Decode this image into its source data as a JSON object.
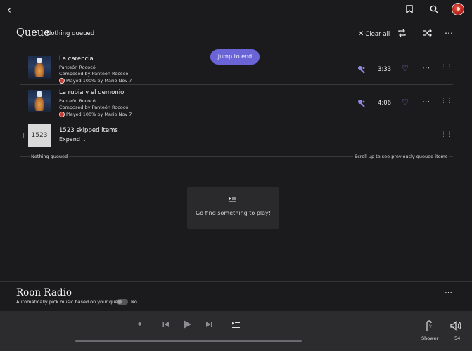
{
  "topbar": {
    "back_icon": "chevron-left-icon",
    "bookmark_icon": "bookmark-icon",
    "search_icon": "search-icon"
  },
  "queue": {
    "title": "Queue",
    "subtitle": "Nothing queued",
    "clear_all": "Clear all",
    "jump_to_end": "Jump to end"
  },
  "tracks": [
    {
      "title": "La carencia",
      "artist": "Panteón Rococó",
      "composer": "Composed by Panteón Rococó",
      "played": "Played 100% by Mario Nov 7",
      "duration": "3:33"
    },
    {
      "title": "La rubia y el demonio",
      "artist": "Panteón Rococó",
      "composer": "Composed by Panteón Rococó",
      "played": "Played 100% by Mario Nov 7",
      "duration": "4:06"
    }
  ],
  "skipped": {
    "count": "1523",
    "label": "1523 skipped items",
    "expand": "Expand"
  },
  "separator": {
    "left": "Nothing queued",
    "right": "Scroll up to see previously queued items"
  },
  "empty": {
    "message": "Go find something to play!"
  },
  "radio": {
    "title": "Roon Radio",
    "description": "Automatically pick music based on your queue",
    "toggle_value": "No"
  },
  "transport": {
    "zone_label": "Shower",
    "volume": "54"
  },
  "colors": {
    "accent": "#6a64d6",
    "background": "#1b1b1d",
    "transport_bg": "#2c2c2f"
  }
}
